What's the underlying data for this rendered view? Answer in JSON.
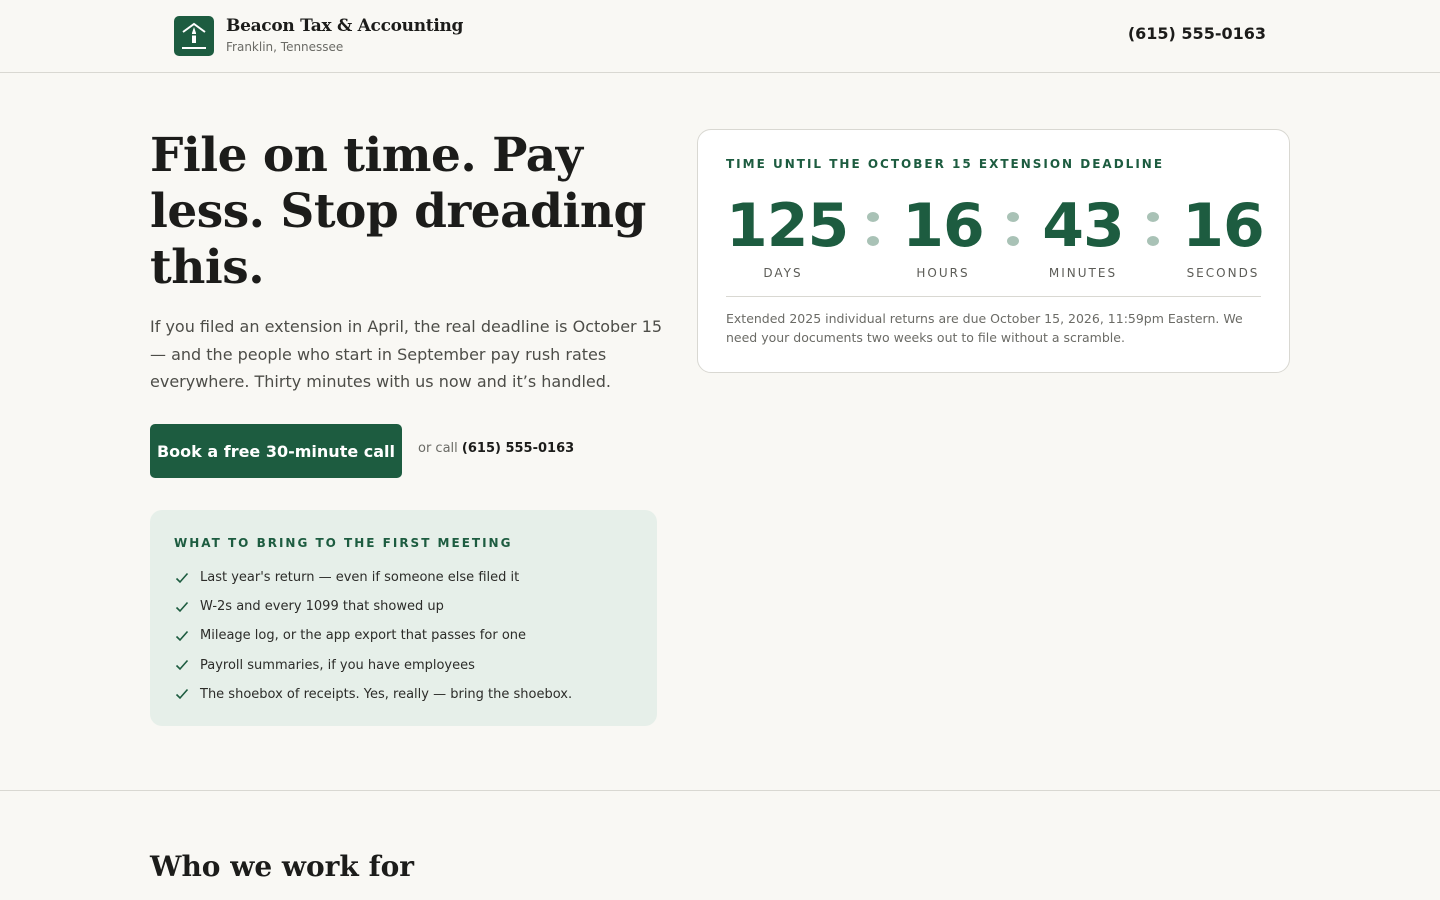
{
  "header": {
    "brand_name": "Beacon Tax & Accounting",
    "brand_location": "Franklin, Tennessee",
    "phone": "(615) 555-0163",
    "logo_icon": "lighthouse-icon"
  },
  "hero": {
    "title": "File on time. Pay less. Stop dreading this.",
    "description": "If you filed an extension in April, the real deadline is October 15 — and the people who start in September pay rush rates everywhere. Thirty minutes with us now and it’s handled.",
    "cta_label": "Book a free 30-minute call",
    "or_call_prefix": "or call",
    "or_call_phone": "(615) 555-0163"
  },
  "bring": {
    "title": "WHAT TO BRING TO THE FIRST MEETING",
    "items": [
      "Last year's return — even if someone else filed it",
      "W-2s and every 1099 that showed up",
      "Mileage log, or the app export that passes for one",
      "Payroll summaries, if you have employees",
      "The shoebox of receipts. Yes, really — bring the shoebox."
    ],
    "icon": "check-icon"
  },
  "countdown": {
    "title": "TIME UNTIL THE OCTOBER 15 EXTENSION DEADLINE",
    "days": "125",
    "days_label": "DAYS",
    "hours": "16",
    "hours_label": "HOURS",
    "minutes": "43",
    "minutes_label": "MINUTES",
    "seconds": "16",
    "seconds_label": "SECONDS",
    "note": "Extended 2025 individual returns are due October 15, 2026, 11:59pm Eastern. We need your documents two weeks out to file without a scramble."
  },
  "section2": {
    "heading": "Who we work for"
  },
  "colors": {
    "accent": "#1d5c40",
    "background": "#f9f8f4",
    "panel": "#e6efe9",
    "separator_dots": "#a9c2b6"
  }
}
